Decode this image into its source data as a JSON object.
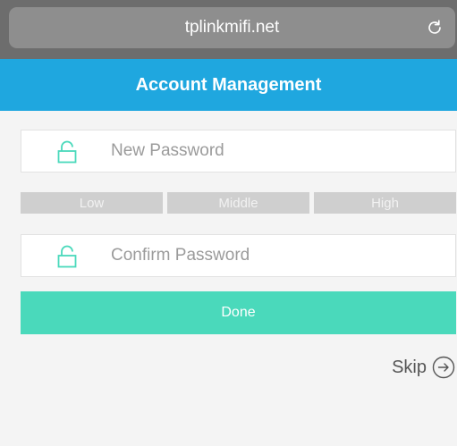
{
  "browser": {
    "url": "tplinkmifi.net",
    "reload_icon": "reload-icon"
  },
  "header": {
    "title": "Account Management"
  },
  "form": {
    "new_password": {
      "placeholder": "New Password",
      "value": "",
      "icon": "lock-icon"
    },
    "strength": {
      "levels": [
        "Low",
        "Middle",
        "High"
      ]
    },
    "confirm_password": {
      "placeholder": "Confirm Password",
      "value": "",
      "icon": "lock-icon"
    },
    "done_label": "Done",
    "skip_label": "Skip",
    "skip_icon": "arrow-right-circle-icon"
  },
  "colors": {
    "header": "#1fa7df",
    "accent": "#4ad9bb",
    "chrome": "#6d6d6d",
    "strength_inactive": "#cfcfcf"
  }
}
